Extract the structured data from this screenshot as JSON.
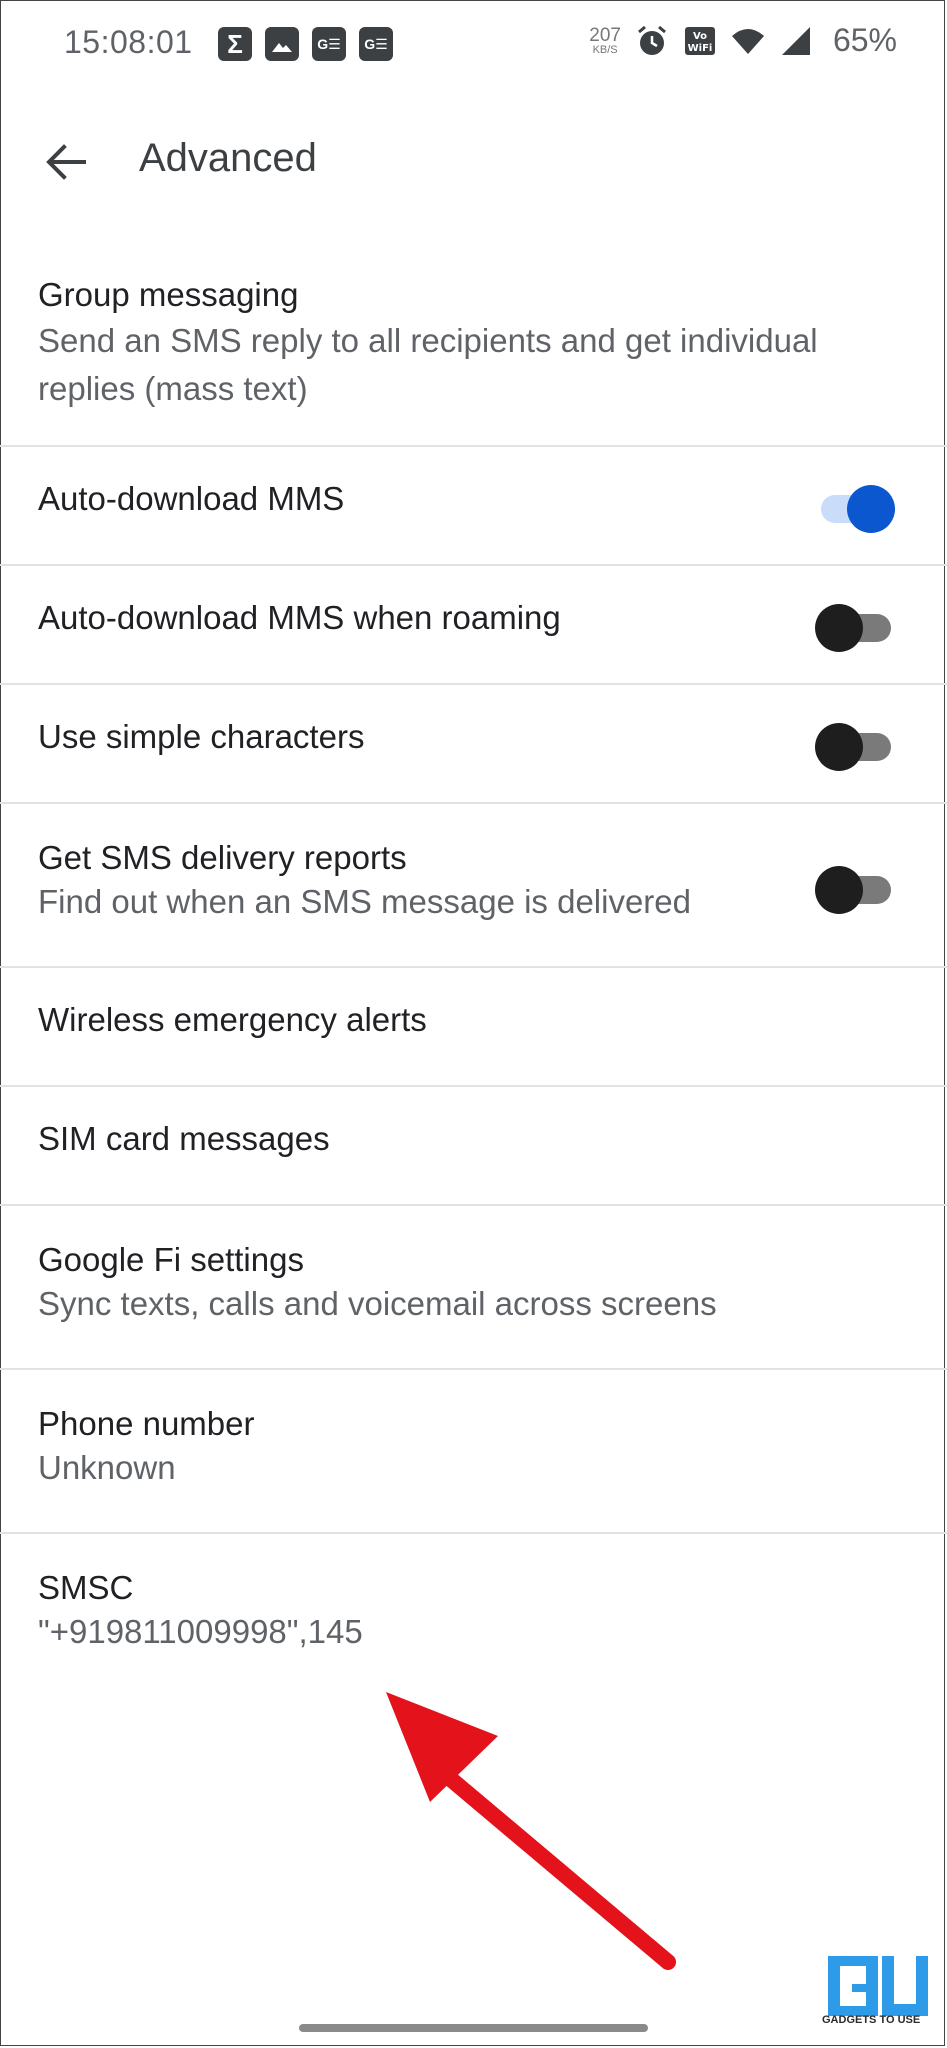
{
  "status_bar": {
    "time": "15:08:01",
    "notification_icons": [
      "sigma-icon",
      "image-icon",
      "news-icon",
      "news-icon"
    ],
    "net_speed_value": "207",
    "net_speed_unit": "KB/S",
    "battery": "65%"
  },
  "header": {
    "title": "Advanced"
  },
  "settings": {
    "group_messaging": {
      "label": "Group messaging",
      "description": "Send an SMS reply to all recipients and get individual replies (mass text)"
    },
    "auto_download_mms": {
      "label": "Auto-download MMS",
      "enabled": true
    },
    "auto_download_roaming": {
      "label": "Auto-download MMS when roaming",
      "enabled": false
    },
    "simple_characters": {
      "label": "Use simple characters",
      "enabled": false
    },
    "delivery_reports": {
      "label": "Get SMS delivery reports",
      "description": "Find out when an SMS message is delivered",
      "enabled": false
    },
    "emergency_alerts": {
      "label": "Wireless emergency alerts"
    },
    "sim_messages": {
      "label": "SIM card messages"
    },
    "google_fi": {
      "label": "Google Fi settings",
      "description": "Sync texts, calls and voicemail across screens"
    },
    "phone_number": {
      "label": "Phone number",
      "value": "Unknown"
    },
    "smsc": {
      "label": "SMSC",
      "value": "\"+919811009998\",145"
    }
  },
  "colors": {
    "accent": "#0a57d0",
    "annotation_arrow": "#e3121b"
  },
  "watermark": {
    "text": "GADGETS TO USE"
  }
}
